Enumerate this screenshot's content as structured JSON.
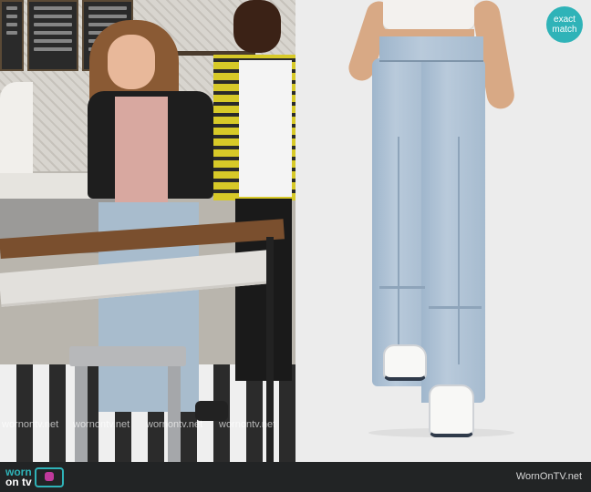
{
  "badge": {
    "line1": "exact",
    "line2": "match",
    "color": "#2fb3b8"
  },
  "watermarks": [
    "wornontv.net",
    "wornontv.net",
    "wornontv.net",
    "wornontv.net"
  ],
  "footer": {
    "logo_line1": "worn",
    "logo_line2": "on tv",
    "site": "WornOnTV.net"
  },
  "colors": {
    "accent": "#2fb3b8",
    "logo_pink": "#c0399b",
    "footer_bg": "#222425"
  },
  "icons": {
    "logo": "tv-icon"
  }
}
